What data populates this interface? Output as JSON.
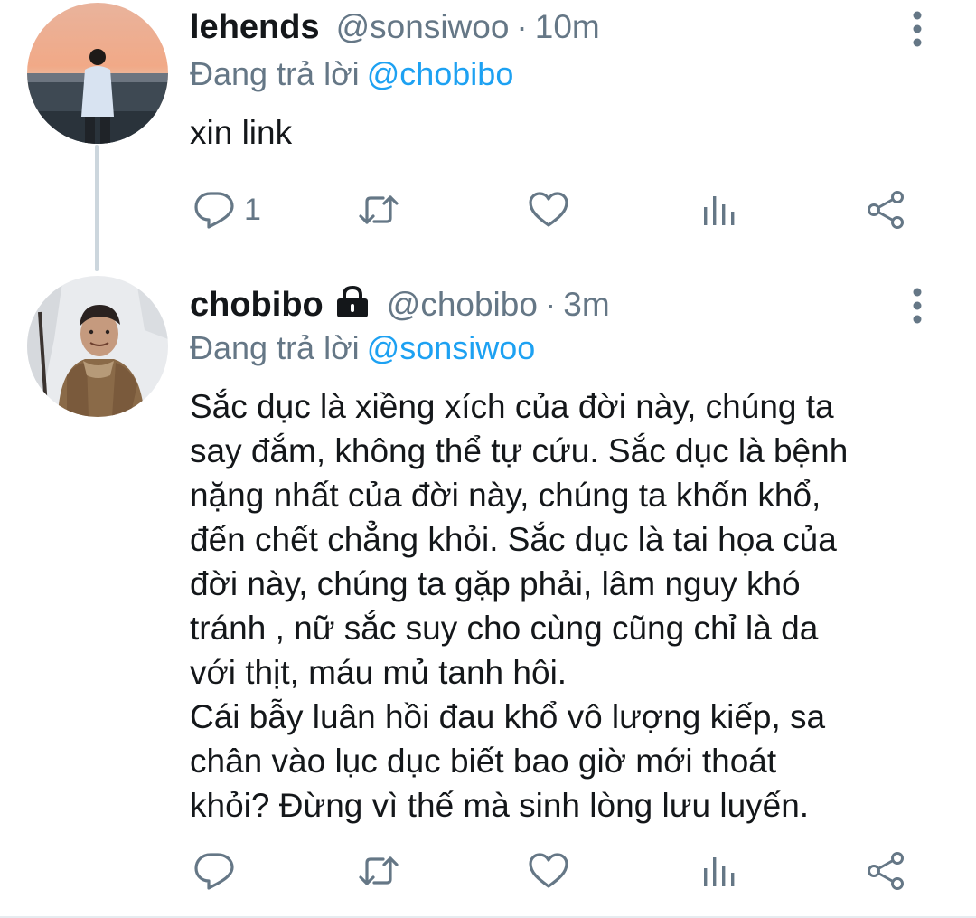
{
  "tweets": [
    {
      "display_name": "lehends",
      "handle": "@sonsiwoo",
      "separator": "·",
      "time": "10m",
      "reply_label": "Đang trả lời",
      "reply_to": "@chobibo",
      "text": "xin link",
      "reply_count": "1",
      "locked": false,
      "avatar_icon": "profile-photo"
    },
    {
      "display_name": "chobibo",
      "handle": "@chobibo",
      "separator": "·",
      "time": "3m",
      "reply_label": "Đang trả lời",
      "reply_to": "@sonsiwoo",
      "text": "Sắc dục là xiềng xích của đời này, chúng ta\nsay đắm, không thể tự cứu. Sắc dục là bệnh\nnặng nhất của đời này, chúng ta khốn khổ,\nđến chết chẳng khỏi. Sắc dục là tai họa của\nđời này, chúng ta gặp phải, lâm nguy khó\ntránh , nữ sắc suy cho cùng cũng chỉ là da\nvới thịt, máu mủ tanh hôi.\nCái bẫy luân hồi đau khổ vô lượng kiếp, sa\nchân vào lục dục biết bao giờ mới thoát\nkhỏi? Đừng vì thế mà sinh lòng lưu luyến.",
      "reply_count": "",
      "locked": true,
      "avatar_icon": "profile-photo"
    }
  ],
  "colors": {
    "text": "#14171a",
    "secondary": "#657786",
    "link": "#1da1f2",
    "thread_line": "#ccd6dd"
  },
  "icons": [
    "reply-icon",
    "retweet-icon",
    "like-icon",
    "stats-icon",
    "share-icon",
    "more-icon",
    "lock-icon"
  ]
}
